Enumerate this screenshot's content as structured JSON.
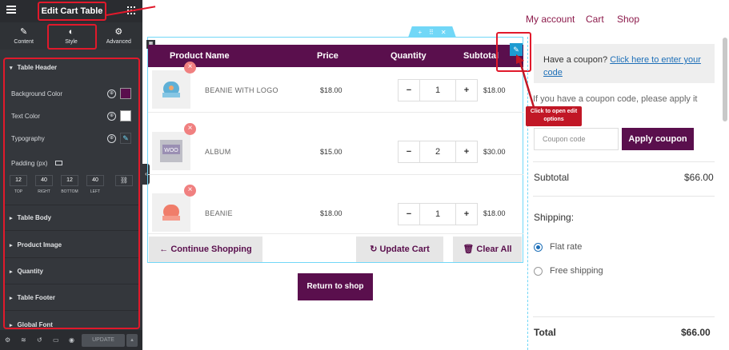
{
  "editor": {
    "title": "Edit Cart Table",
    "tabs": [
      {
        "label": "Content",
        "icon": "pencil-icon"
      },
      {
        "label": "Style",
        "icon": "contrast-icon"
      },
      {
        "label": "Advanced",
        "icon": "gear-icon"
      }
    ],
    "section_open": "Table Header",
    "controls": {
      "background_color": {
        "label": "Background Color",
        "value": "#5a0f4d"
      },
      "text_color": {
        "label": "Text Color",
        "value": "#ffffff"
      },
      "typography": {
        "label": "Typography"
      },
      "padding": {
        "label": "Padding (px)",
        "values": [
          "12",
          "40",
          "12",
          "40"
        ],
        "captions": [
          "TOP",
          "RIGHT",
          "BOTTOM",
          "LEFT"
        ]
      }
    },
    "sections": [
      "Table Body",
      "Product Image",
      "Quantity",
      "Table Footer",
      "Global Font"
    ],
    "footer": {
      "update_label": "UPDATE"
    }
  },
  "nav": {
    "links": [
      "My account",
      "Cart",
      "Shop"
    ]
  },
  "cart": {
    "headers": [
      "Product Name",
      "Price",
      "Quantity",
      "Subtotal"
    ],
    "rows": [
      {
        "name": "BEANIE WITH LOGO",
        "price": "$18.00",
        "qty": "1",
        "subtotal": "$18.00"
      },
      {
        "name": "ALBUM",
        "price": "$15.00",
        "qty": "2",
        "subtotal": "$30.00"
      },
      {
        "name": "BEANIE",
        "price": "$18.00",
        "qty": "1",
        "subtotal": "$18.00"
      }
    ],
    "continue_label": "Continue Shopping",
    "update_label": "Update Cart",
    "clear_label": "Clear All",
    "return_label": "Return to shop",
    "accent_color": "#5a0f4d"
  },
  "coupon": {
    "prompt": "Have a coupon?",
    "link": "Click here to enter your code",
    "description": "If you have a coupon code, please apply it",
    "placeholder": "Coupon code",
    "apply_label": "Apply coupon"
  },
  "callout": {
    "text": "Click to open edit options"
  },
  "totals": {
    "subtotal_label": "Subtotal",
    "subtotal_value": "$66.00",
    "shipping_label": "Shipping:",
    "rates": [
      "Flat rate",
      "Free shipping"
    ],
    "total_label": "Total",
    "total_value": "$66.00"
  }
}
